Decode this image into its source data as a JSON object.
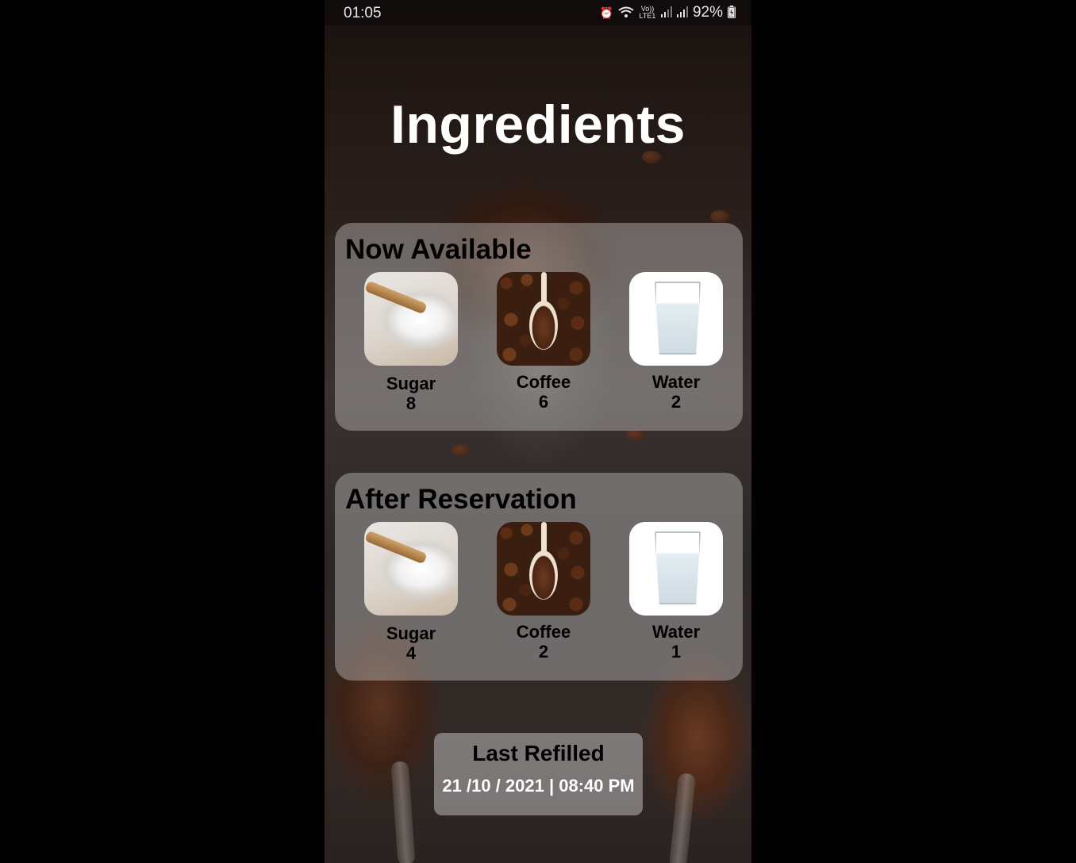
{
  "status_bar": {
    "time": "01:05",
    "icons": [
      "alarm-icon",
      "wifi-icon",
      "volte-icon",
      "signal-icon",
      "signal-icon",
      "battery-charging-icon"
    ],
    "volte_text": "Vo)) LTE1",
    "battery": "92%"
  },
  "page": {
    "title": "Ingredients"
  },
  "now_available": {
    "title": "Now Available",
    "items": [
      {
        "name": "Sugar",
        "count": "8",
        "icon": "sugar-image"
      },
      {
        "name": "Coffee",
        "count": "6",
        "icon": "coffee-image"
      },
      {
        "name": "Water",
        "count": "2",
        "icon": "water-glass-image"
      }
    ]
  },
  "after_reservation": {
    "title": "After Reservation",
    "items": [
      {
        "name": "Sugar",
        "count": "4",
        "icon": "sugar-image"
      },
      {
        "name": "Coffee",
        "count": "2",
        "icon": "coffee-image"
      },
      {
        "name": "Water",
        "count": "1",
        "icon": "water-glass-image"
      }
    ]
  },
  "last_refilled": {
    "label": "Last Refilled",
    "value": "21 /10 / 2021 | 08:40 PM"
  }
}
